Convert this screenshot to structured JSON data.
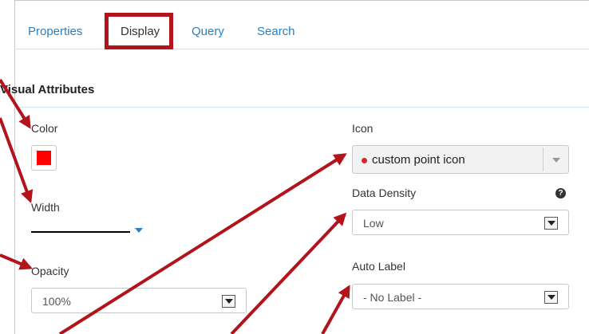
{
  "tabs": [
    {
      "label": "Properties",
      "active": false
    },
    {
      "label": "Display",
      "active": true
    },
    {
      "label": "Query",
      "active": false
    },
    {
      "label": "Search",
      "active": false
    }
  ],
  "section": {
    "title": "Visual Attributes"
  },
  "fields": {
    "color": {
      "label": "Color",
      "value": "#ff0000"
    },
    "width": {
      "label": "Width"
    },
    "opacity": {
      "label": "Opacity",
      "value": "100%"
    },
    "icon": {
      "label": "Icon",
      "value": "custom point icon",
      "icon_color": "#d9232d"
    },
    "data_density": {
      "label": "Data Density",
      "value": "Low",
      "help_glyph": "?"
    },
    "auto_label": {
      "label": "Auto Label",
      "value": "- No Label -"
    }
  },
  "annotation": {
    "color": "#b3131b"
  }
}
